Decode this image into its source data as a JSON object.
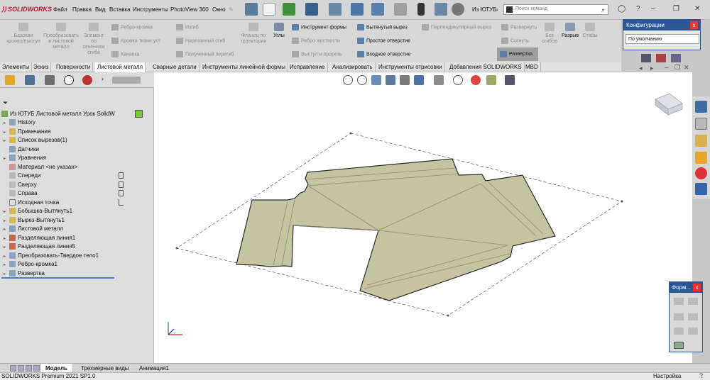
{
  "app": {
    "logo_text": "SOLIDWORKS",
    "menu": [
      "Файл",
      "Правка",
      "Вид",
      "Вставка",
      "Инструменты",
      "PhotoView 360",
      "Окно"
    ],
    "document_title": "Из ЮТУБ",
    "search_placeholder": "Поиск команд",
    "accent_color": "#2b5797"
  },
  "ribbon": {
    "col1": [
      "Базовая",
      "кромка/выступ"
    ],
    "col2": [
      "Преобразовать",
      "в листовой",
      "металл"
    ],
    "col3": [
      "Элемент",
      "по",
      "сечениям",
      "сгиба"
    ],
    "items_left": [
      "Ребро-кромка",
      "Кромка ткани угл",
      "Канавка"
    ],
    "items_mid": [
      "Изгиб",
      "Нарезанный сгиб",
      "Полученный перегиб"
    ],
    "flange_path": [
      "Фланец по",
      "траектории"
    ],
    "corners_label": "Углы",
    "form_tool": "Инструмент формы",
    "stiffener": "Ребро жесткости",
    "vent_cut": "Выступ и прорезь",
    "extruded_cut": "Вытянутый вырез",
    "simple_hole": "Простое отверстие",
    "vent": "Входное отверстие",
    "normal_cut": "Перпендикулярный вырез",
    "unfold": "Развернуть",
    "fold": "Согнуть",
    "flatten": "Развертка",
    "no_bends": [
      "Без",
      "сгибов"
    ],
    "rip": "Разрыв",
    "tabs_label": "Стабы"
  },
  "configuration": {
    "title": "Конфигурации",
    "selected": "По умолчанию",
    "close": "x"
  },
  "tabs": [
    {
      "label": "Элементы",
      "active": false
    },
    {
      "label": "Эскиз",
      "active": false
    },
    {
      "label": "Поверхности",
      "active": false
    },
    {
      "label": "Листовой металл",
      "active": true
    },
    {
      "label": "Сварные детали",
      "active": false
    },
    {
      "label": "Инструменты линейной формы",
      "active": false
    },
    {
      "label": "Исправление",
      "active": false
    },
    {
      "label": "Анализировать",
      "active": false
    },
    {
      "label": "Инструменты отрисовки",
      "active": false
    },
    {
      "label": "Добавления SOLIDWORKS",
      "active": false
    },
    {
      "label": "MBD",
      "active": false
    }
  ],
  "feature_tree": {
    "root": "Из ЮТУБ Листовой металл Урок SolidW",
    "items": [
      {
        "label": "History",
        "icon": "history-icon"
      },
      {
        "label": "Примечания",
        "icon": "notes-icon"
      },
      {
        "label": "Список вырезов(1)",
        "icon": "cutlist-icon"
      },
      {
        "label": "Датчики",
        "icon": "sensor-icon"
      },
      {
        "label": "Уравнения",
        "icon": "equation-icon"
      },
      {
        "label": "Материал <не указан>",
        "icon": "material-icon"
      },
      {
        "label": "Спереди",
        "icon": "plane-icon"
      },
      {
        "label": "Сверху",
        "icon": "plane-icon"
      },
      {
        "label": "Справа",
        "icon": "plane-icon"
      },
      {
        "label": "Исходная точка",
        "icon": "origin-icon"
      },
      {
        "label": "Бобышка-Вытянуть1",
        "icon": "boss-icon"
      },
      {
        "label": "Вырез-Вытянуть1",
        "icon": "cut-icon"
      },
      {
        "label": "Листовой металл",
        "icon": "sheetmetal-icon"
      },
      {
        "label": "Разделяющая линия1",
        "icon": "splitline-icon"
      },
      {
        "label": "Разделяющая линия5",
        "icon": "splitline-icon"
      },
      {
        "label": "Преобразовать-Твердое тело1",
        "icon": "convert-icon"
      },
      {
        "label": "Ребро-кромка1",
        "icon": "edgeflange-icon"
      },
      {
        "label": "Развертка",
        "icon": "flatpattern-icon"
      }
    ]
  },
  "form_panel": {
    "title": "Форм...",
    "close": "x"
  },
  "bottom_tabs": [
    {
      "label": "Модель",
      "active": true
    },
    {
      "label": "Трехмерные виды",
      "active": false
    },
    {
      "label": "Анимация1",
      "active": false
    }
  ],
  "status": {
    "left": "SOLIDWORKS Premium 2021 SP1.0",
    "right": "Настройка"
  },
  "flat_pattern_color": "#c4c4a1"
}
